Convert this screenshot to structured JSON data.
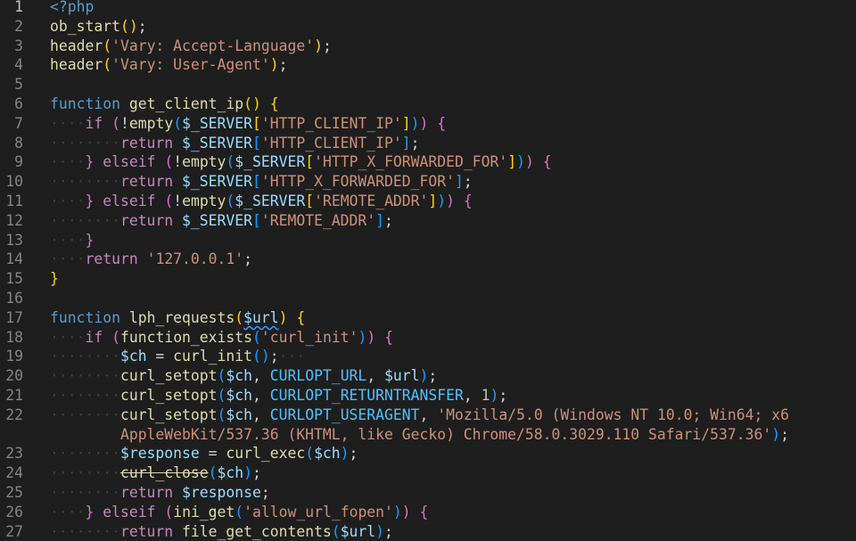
{
  "editor": {
    "language": "php",
    "active_line": "1",
    "colors": {
      "background": "#1e1e1e",
      "line_number": "#858585",
      "keyword": "#569cd6",
      "control": "#c586c0",
      "function": "#dcdcaa",
      "string": "#ce9178",
      "variable": "#9cdcfe",
      "number": "#b5cea8"
    },
    "lines": [
      {
        "n": "1",
        "segs": [
          [
            "kw",
            "<?php"
          ]
        ]
      },
      {
        "n": "2",
        "segs": [
          [
            "fn",
            "ob_start"
          ],
          [
            "p1",
            "()"
          ],
          [
            "pl",
            ";"
          ]
        ]
      },
      {
        "n": "3",
        "segs": [
          [
            "fn",
            "header"
          ],
          [
            "p1",
            "("
          ],
          [
            "str",
            "'Vary: Accept-Language'"
          ],
          [
            "p1",
            ")"
          ],
          [
            "pl",
            ";"
          ]
        ]
      },
      {
        "n": "4",
        "segs": [
          [
            "fn",
            "header"
          ],
          [
            "p1",
            "("
          ],
          [
            "str",
            "'Vary: User-Agent'"
          ],
          [
            "p1",
            ")"
          ],
          [
            "pl",
            ";"
          ]
        ]
      },
      {
        "n": "5",
        "segs": []
      },
      {
        "n": "6",
        "segs": [
          [
            "kw",
            "function"
          ],
          [
            "pl",
            " "
          ],
          [
            "fn",
            "get_client_ip"
          ],
          [
            "p1",
            "()"
          ],
          [
            "pl",
            " "
          ],
          [
            "p1",
            "{"
          ]
        ]
      },
      {
        "n": "7",
        "segs": [
          [
            "ws",
            "····"
          ],
          [
            "ctl",
            "if"
          ],
          [
            "pl",
            " "
          ],
          [
            "p2",
            "("
          ],
          [
            "pl",
            "!"
          ],
          [
            "fn",
            "empty"
          ],
          [
            "p3",
            "("
          ],
          [
            "var",
            "$_SERVER"
          ],
          [
            "p1",
            "["
          ],
          [
            "str",
            "'HTTP_CLIENT_IP'"
          ],
          [
            "p1",
            "]"
          ],
          [
            "p3",
            ")"
          ],
          [
            "p2",
            ")"
          ],
          [
            "pl",
            " "
          ],
          [
            "p2",
            "{"
          ]
        ]
      },
      {
        "n": "8",
        "segs": [
          [
            "ws",
            "········"
          ],
          [
            "ctl",
            "return"
          ],
          [
            "pl",
            " "
          ],
          [
            "var",
            "$_SERVER"
          ],
          [
            "p3",
            "["
          ],
          [
            "str",
            "'HTTP_CLIENT_IP'"
          ],
          [
            "p3",
            "]"
          ],
          [
            "pl",
            ";"
          ]
        ]
      },
      {
        "n": "9",
        "segs": [
          [
            "ws",
            "····"
          ],
          [
            "p2",
            "}"
          ],
          [
            "pl",
            " "
          ],
          [
            "ctl",
            "elseif"
          ],
          [
            "pl",
            " "
          ],
          [
            "p2",
            "("
          ],
          [
            "pl",
            "!"
          ],
          [
            "fn",
            "empty"
          ],
          [
            "p3",
            "("
          ],
          [
            "var",
            "$_SERVER"
          ],
          [
            "p1",
            "["
          ],
          [
            "str",
            "'HTTP_X_FORWARDED_FOR'"
          ],
          [
            "p1",
            "]"
          ],
          [
            "p3",
            ")"
          ],
          [
            "p2",
            ")"
          ],
          [
            "pl",
            " "
          ],
          [
            "p2",
            "{"
          ]
        ]
      },
      {
        "n": "10",
        "segs": [
          [
            "ws",
            "········"
          ],
          [
            "ctl",
            "return"
          ],
          [
            "pl",
            " "
          ],
          [
            "var",
            "$_SERVER"
          ],
          [
            "p3",
            "["
          ],
          [
            "str",
            "'HTTP_X_FORWARDED_FOR'"
          ],
          [
            "p3",
            "]"
          ],
          [
            "pl",
            ";"
          ]
        ]
      },
      {
        "n": "11",
        "segs": [
          [
            "ws",
            "····"
          ],
          [
            "p2",
            "}"
          ],
          [
            "pl",
            " "
          ],
          [
            "ctl",
            "elseif"
          ],
          [
            "pl",
            " "
          ],
          [
            "p2",
            "("
          ],
          [
            "pl",
            "!"
          ],
          [
            "fn",
            "empty"
          ],
          [
            "p3",
            "("
          ],
          [
            "var",
            "$_SERVER"
          ],
          [
            "p1",
            "["
          ],
          [
            "str",
            "'REMOTE_ADDR'"
          ],
          [
            "p1",
            "]"
          ],
          [
            "p3",
            ")"
          ],
          [
            "p2",
            ")"
          ],
          [
            "pl",
            " "
          ],
          [
            "p2",
            "{"
          ]
        ]
      },
      {
        "n": "12",
        "segs": [
          [
            "ws",
            "········"
          ],
          [
            "ctl",
            "return"
          ],
          [
            "pl",
            " "
          ],
          [
            "var",
            "$_SERVER"
          ],
          [
            "p3",
            "["
          ],
          [
            "str",
            "'REMOTE_ADDR'"
          ],
          [
            "p3",
            "]"
          ],
          [
            "pl",
            ";"
          ]
        ]
      },
      {
        "n": "13",
        "segs": [
          [
            "ws",
            "····"
          ],
          [
            "p2",
            "}"
          ]
        ]
      },
      {
        "n": "14",
        "segs": [
          [
            "ws",
            "····"
          ],
          [
            "ctl",
            "return"
          ],
          [
            "pl",
            " "
          ],
          [
            "str",
            "'127.0.0.1'"
          ],
          [
            "pl",
            ";"
          ]
        ]
      },
      {
        "n": "15",
        "segs": [
          [
            "p1",
            "}"
          ]
        ]
      },
      {
        "n": "16",
        "segs": []
      },
      {
        "n": "17",
        "segs": [
          [
            "kw",
            "function"
          ],
          [
            "pl",
            " "
          ],
          [
            "fn",
            "lph_requests"
          ],
          [
            "p1",
            "("
          ],
          [
            "squig",
            "$url"
          ],
          [
            "p1",
            ")"
          ],
          [
            "pl",
            " "
          ],
          [
            "p1",
            "{"
          ]
        ]
      },
      {
        "n": "18",
        "segs": [
          [
            "ws",
            "····"
          ],
          [
            "ctl",
            "if"
          ],
          [
            "pl",
            " "
          ],
          [
            "p2",
            "("
          ],
          [
            "fn",
            "function_exists"
          ],
          [
            "p3",
            "("
          ],
          [
            "str",
            "'curl_init'"
          ],
          [
            "p3",
            ")"
          ],
          [
            "p2",
            ")"
          ],
          [
            "pl",
            " "
          ],
          [
            "p2",
            "{"
          ]
        ]
      },
      {
        "n": "19",
        "segs": [
          [
            "ws",
            "········"
          ],
          [
            "var",
            "$ch"
          ],
          [
            "pl",
            " = "
          ],
          [
            "fn",
            "curl_init"
          ],
          [
            "p3",
            "()"
          ],
          [
            "pl",
            ";"
          ],
          [
            "ws",
            "···"
          ]
        ]
      },
      {
        "n": "20",
        "segs": [
          [
            "ws",
            "········"
          ],
          [
            "fn",
            "curl_setopt"
          ],
          [
            "p3",
            "("
          ],
          [
            "var",
            "$ch"
          ],
          [
            "pl",
            ", "
          ],
          [
            "const",
            "CURLOPT_URL"
          ],
          [
            "pl",
            ", "
          ],
          [
            "var",
            "$url"
          ],
          [
            "p3",
            ")"
          ],
          [
            "pl",
            ";"
          ]
        ]
      },
      {
        "n": "21",
        "segs": [
          [
            "ws",
            "········"
          ],
          [
            "fn",
            "curl_setopt"
          ],
          [
            "p3",
            "("
          ],
          [
            "var",
            "$ch"
          ],
          [
            "pl",
            ", "
          ],
          [
            "const",
            "CURLOPT_RETURNTRANSFER"
          ],
          [
            "pl",
            ", "
          ],
          [
            "num",
            "1"
          ],
          [
            "p3",
            ")"
          ],
          [
            "pl",
            ";"
          ]
        ]
      },
      {
        "n": "22",
        "segs": [
          [
            "ws",
            "········"
          ],
          [
            "fn",
            "curl_setopt"
          ],
          [
            "p3",
            "("
          ],
          [
            "var",
            "$ch"
          ],
          [
            "pl",
            ", "
          ],
          [
            "const",
            "CURLOPT_USERAGENT"
          ],
          [
            "pl",
            ", "
          ],
          [
            "str",
            "'Mozilla/5.0 (Windows NT 10.0; Win64; x6"
          ]
        ]
      },
      {
        "n": "",
        "segs": [
          [
            "pl",
            "        "
          ],
          [
            "str",
            "AppleWebKit/537.36 (KHTML, like Gecko) Chrome/58.0.3029.110 Safari/537.36'"
          ],
          [
            "p3",
            ")"
          ],
          [
            "pl",
            ";"
          ]
        ]
      },
      {
        "n": "23",
        "segs": [
          [
            "ws",
            "········"
          ],
          [
            "var",
            "$response"
          ],
          [
            "pl",
            " = "
          ],
          [
            "fn",
            "curl_exec"
          ],
          [
            "p3",
            "("
          ],
          [
            "var",
            "$ch"
          ],
          [
            "p3",
            ")"
          ],
          [
            "pl",
            ";"
          ]
        ]
      },
      {
        "n": "24",
        "segs": [
          [
            "ws",
            "········"
          ],
          [
            "strike",
            "curl_close"
          ],
          [
            "p3",
            "("
          ],
          [
            "var",
            "$ch"
          ],
          [
            "p3",
            ")"
          ],
          [
            "pl",
            ";"
          ]
        ]
      },
      {
        "n": "25",
        "segs": [
          [
            "ws",
            "········"
          ],
          [
            "ctl",
            "return"
          ],
          [
            "pl",
            " "
          ],
          [
            "var",
            "$response"
          ],
          [
            "pl",
            ";"
          ]
        ]
      },
      {
        "n": "26",
        "segs": [
          [
            "ws",
            "····"
          ],
          [
            "p2",
            "}"
          ],
          [
            "pl",
            " "
          ],
          [
            "ctl",
            "elseif"
          ],
          [
            "pl",
            " "
          ],
          [
            "p2",
            "("
          ],
          [
            "fn",
            "ini_get"
          ],
          [
            "p3",
            "("
          ],
          [
            "str",
            "'allow_url_fopen'"
          ],
          [
            "p3",
            ")"
          ],
          [
            "p2",
            ")"
          ],
          [
            "pl",
            " "
          ],
          [
            "p2",
            "{"
          ]
        ]
      },
      {
        "n": "27",
        "segs": [
          [
            "ws",
            "········"
          ],
          [
            "ctl",
            "return"
          ],
          [
            "pl",
            " "
          ],
          [
            "fn",
            "file_get_contents"
          ],
          [
            "p3",
            "("
          ],
          [
            "var",
            "$url"
          ],
          [
            "p3",
            ")"
          ],
          [
            "pl",
            ";"
          ]
        ]
      }
    ]
  }
}
